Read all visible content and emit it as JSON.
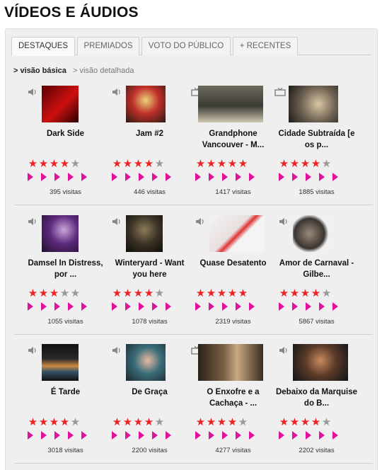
{
  "page": {
    "title": "VÍDEOS E ÁUDIOS"
  },
  "tabs": [
    {
      "label": "DESTAQUES",
      "active": true
    },
    {
      "label": "PREMIADOS",
      "active": false
    },
    {
      "label": "VOTO DO PÚBLICO",
      "active": false
    },
    {
      "label": "+ RECENTES",
      "active": false
    }
  ],
  "view_toggle": {
    "basic": "> visão básica",
    "detailed": "> visão detalhada"
  },
  "colors": {
    "star_on": "#ee2222",
    "star_off": "#999999",
    "arrow": "#e0119a"
  },
  "items": [
    {
      "title": "Dark Side",
      "type": "audio",
      "rating": 4,
      "visits": "395 visitas"
    },
    {
      "title": "Jam #2",
      "type": "audio",
      "rating": 4,
      "visits": "446 visitas"
    },
    {
      "title": "Grandphone Vancouver - M...",
      "type": "video",
      "rating": 5,
      "visits": "1417 visitas"
    },
    {
      "title": "Cidade Subtraída [e os p...",
      "type": "video",
      "rating": 4,
      "visits": "1885 visitas"
    },
    {
      "title": "Damsel In Distress, por ...",
      "type": "audio",
      "rating": 3,
      "visits": "1055 visitas"
    },
    {
      "title": "Winteryard - Want you here",
      "type": "audio",
      "rating": 4,
      "visits": "1078 visitas"
    },
    {
      "title": "Quase Desatento",
      "type": "audio",
      "rating": 5,
      "visits": "2319 visitas"
    },
    {
      "title": "Amor de Carnaval - Gilbe...",
      "type": "audio",
      "rating": 4,
      "visits": "5867 visitas"
    },
    {
      "title": "É Tarde",
      "type": "audio",
      "rating": 4,
      "visits": "3018 visitas"
    },
    {
      "title": "De Graça",
      "type": "audio",
      "rating": 4,
      "visits": "2200 visitas"
    },
    {
      "title": "O Enxofre e a Cachaça - ...",
      "type": "video",
      "rating": 4,
      "visits": "4277 visitas"
    },
    {
      "title": "Debaixo da Marquise do B...",
      "type": "audio",
      "rating": 4,
      "visits": "2202 visitas"
    }
  ]
}
